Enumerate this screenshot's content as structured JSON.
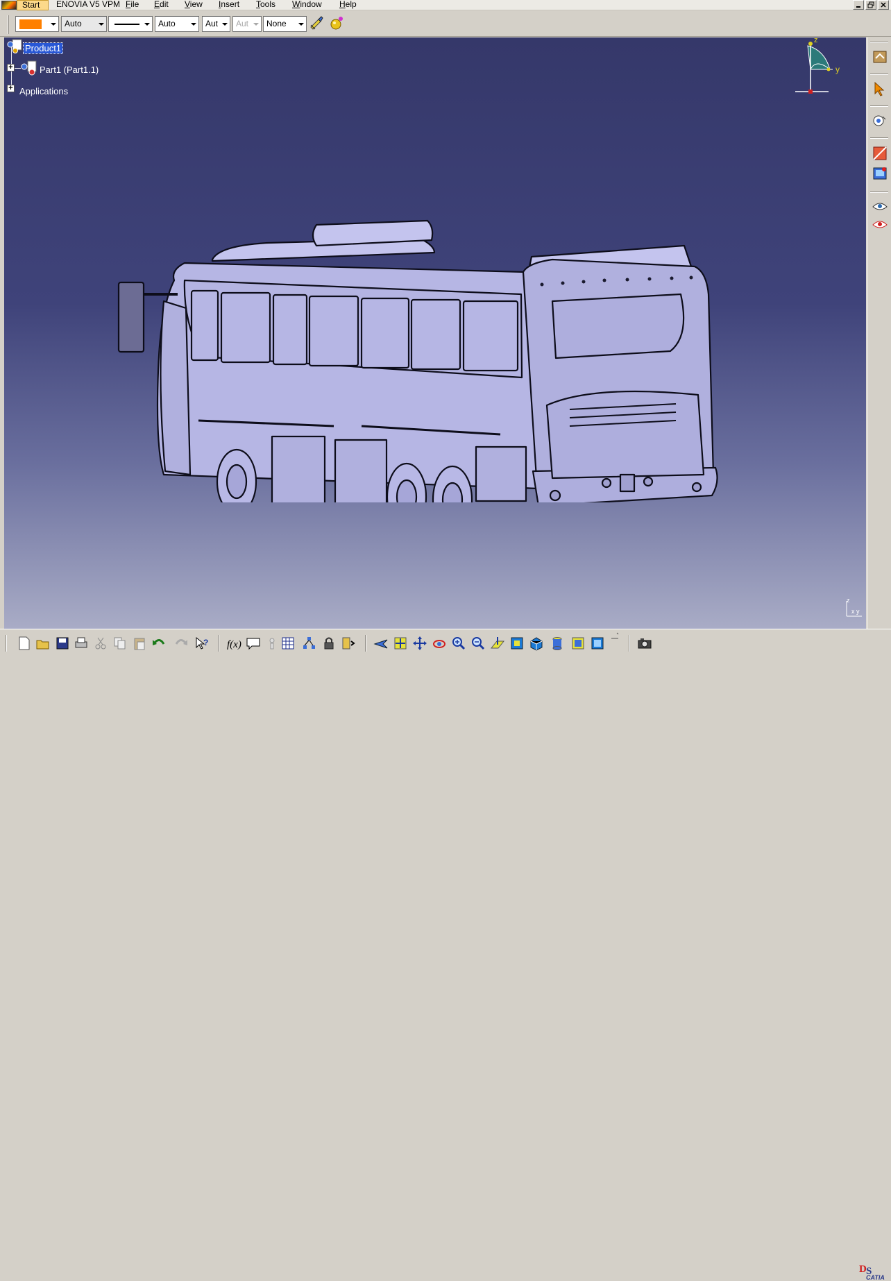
{
  "menubar": {
    "start": "Start",
    "items": [
      "ENOVIA V5 VPM",
      "File",
      "Edit",
      "View",
      "Insert",
      "Tools",
      "Window",
      "Help"
    ]
  },
  "properties_toolbar": {
    "color_value": "#ff8000",
    "transparency": "Auto",
    "thickness": "Auto",
    "line_weight": "Aut",
    "point_symbol": "Aut",
    "layer": "None"
  },
  "spec_tree": {
    "root": "Product1",
    "part": "Part1 (Part1.1)",
    "applications": "Applications"
  },
  "compass": {
    "z_label": "z",
    "y_label": "y"
  },
  "mini_axis": {
    "z_label": "z",
    "xy_label": "x y"
  },
  "viewport": {
    "background_top": "#35386a",
    "background_bottom": "#a9acc6",
    "model_color": "#b8b8e6"
  },
  "right_toolbar": {
    "icons": [
      "catalog-icon",
      "select-icon",
      "snap-icon",
      "section-icon",
      "render-icon",
      "hide-show-icon",
      "swap-visible-icon"
    ]
  },
  "bottom_toolbar": {
    "icons": [
      "new-icon",
      "open-icon",
      "save-icon",
      "print-icon",
      "cut-icon",
      "copy-icon",
      "paste-icon",
      "undo-icon",
      "redo-icon",
      "whats-this-icon",
      "formula-icon",
      "comment-icon",
      "knowledge-icon",
      "table-icon",
      "graph-icon",
      "lock-icon",
      "macro-icon",
      "fly-icon",
      "fit-all-icon",
      "pan-icon",
      "rotate-icon",
      "zoom-in-icon",
      "zoom-out-icon",
      "normal-view-icon",
      "iso-view-icon",
      "view-mode-icon",
      "shading-icon",
      "hide-icon",
      "swap-icon",
      "capture-icon"
    ],
    "logo_text": "CATIA"
  }
}
